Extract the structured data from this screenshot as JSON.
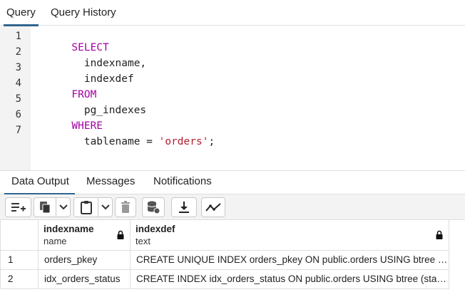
{
  "query_tabs": [
    "Query",
    "Query History"
  ],
  "editor": {
    "line_numbers": [
      "1",
      "2",
      "3",
      "4",
      "5",
      "6",
      "7"
    ],
    "lines": [
      [
        {
          "t": "SELECT",
          "k": "kw"
        }
      ],
      [
        {
          "t": "  indexname,",
          "k": ""
        }
      ],
      [
        {
          "t": "  indexdef",
          "k": ""
        }
      ],
      [
        {
          "t": "FROM",
          "k": "kw"
        }
      ],
      [
        {
          "t": "  pg_indexes",
          "k": ""
        }
      ],
      [
        {
          "t": "WHERE",
          "k": "kw"
        }
      ],
      [
        {
          "t": "  tablename = ",
          "k": ""
        },
        {
          "t": "'orders'",
          "k": "str"
        },
        {
          "t": ";",
          "k": ""
        }
      ]
    ]
  },
  "result_tabs": [
    "Data Output",
    "Messages",
    "Notifications"
  ],
  "toolbar": {
    "icons": [
      "add-row-icon",
      "copy-icon",
      "chevron-down-icon",
      "paste-icon",
      "chevron-down-icon",
      "delete-icon",
      "save-data-icon",
      "download-icon",
      "graph-icon"
    ]
  },
  "grid": {
    "columns": [
      {
        "name": "indexname",
        "type": "name"
      },
      {
        "name": "indexdef",
        "type": "text"
      }
    ],
    "rows": [
      {
        "num": "1",
        "cells": [
          "orders_pkey",
          "CREATE UNIQUE INDEX orders_pkey ON public.orders USING btree (id)"
        ]
      },
      {
        "num": "2",
        "cells": [
          "idx_orders_status",
          "CREATE INDEX idx_orders_status ON public.orders USING btree (statu…"
        ]
      }
    ]
  },
  "colors": {
    "keyword": "#a300a3",
    "string": "#b01d2e",
    "active_tab": "#326690"
  }
}
